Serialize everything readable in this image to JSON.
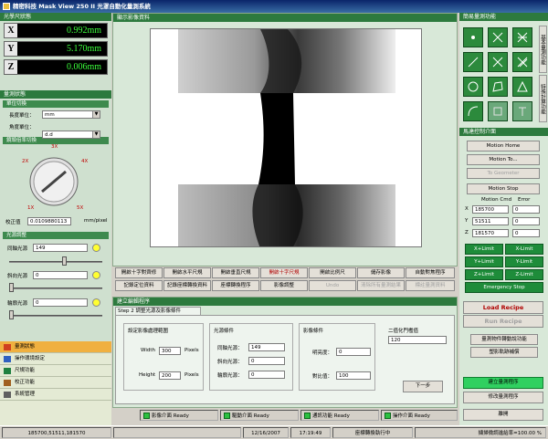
{
  "window": {
    "title": "精密科技 Mask View 250 II 光罩自動化量測系統"
  },
  "coords": {
    "header": "光學尺狀態",
    "rows": [
      {
        "axis": "X",
        "value": "0.992mm"
      },
      {
        "axis": "Y",
        "value": "5.170mm"
      },
      {
        "axis": "Z",
        "value": "0.006mm"
      }
    ]
  },
  "measure": {
    "header": "量測狀態",
    "units_header": "單位切換",
    "length_label": "長度單位：",
    "length_value": "mm",
    "angle_label": "角度單位：",
    "angle_value": "d.d",
    "lens_header": "鏡頭倍率切換",
    "lens_marks": [
      "2X",
      "3X",
      "4X",
      "1X",
      "5X"
    ],
    "calib_label": "校正值",
    "calib_value": "0.0109880113",
    "calib_unit": "mm/pixel",
    "light_header": "光源調整",
    "lights": [
      {
        "label": "同軸光源",
        "value": "149"
      },
      {
        "label": "斜向光源",
        "value": "0"
      },
      {
        "label": "輪廓光源",
        "value": "0"
      }
    ]
  },
  "nav": {
    "items": [
      {
        "label": "量測狀態"
      },
      {
        "label": "操作環境設定"
      },
      {
        "label": "尺規功能"
      },
      {
        "label": "校正功能"
      },
      {
        "label": "系統管理"
      }
    ]
  },
  "image_panel": {
    "header": "顯示影像資料"
  },
  "toolbar": {
    "row1": [
      "開啟十字對齊修",
      "開啟水平尺規",
      "開啟垂直尺規",
      "開啟十字尺規",
      "開啟比例尺",
      "儲存影像",
      "自動對焦程序"
    ],
    "row2": [
      "記錄定位資料",
      "記錄座標轉換資料",
      "座標轉換程序",
      "影像調整",
      "Undo",
      "清除所有量測結果",
      "標註量測資料"
    ]
  },
  "recipe": {
    "header": "建立編輯程序",
    "tab": "Step 2 調整光源及影像條件",
    "range_title": "設定影像處理範圍",
    "width_label": "Width",
    "width_value": "300",
    "height_label": "Height",
    "height_value": "200",
    "unit": "Pixels",
    "light_title": "光源條件",
    "light_rows": [
      {
        "label": "同軸光源：",
        "value": "149"
      },
      {
        "label": "斜向光源：",
        "value": "0"
      },
      {
        "label": "輪廓光源：",
        "value": "0"
      }
    ],
    "image_title": "影像條件",
    "brightness_label": "明亮度：",
    "brightness_value": "0",
    "contrast_label": "對比值：",
    "contrast_value": "100",
    "binary_label": "二值化門檻值",
    "binary_value": "120",
    "next_button": "下一步"
  },
  "status_tabs": [
    "影像介面 Ready",
    "驅動介面 Ready",
    "通訊功能 Ready",
    "操作介面 Ready"
  ],
  "tools": {
    "header": "簡易量測功能",
    "vtabs": [
      "基本量測功能",
      "特殊計算功能"
    ]
  },
  "motion": {
    "header": "馬達控制介面",
    "buttons": [
      "Motion Home",
      "Motion To...",
      "To Geometer",
      "Motion Stop"
    ],
    "cmd_label": "Motion Cmd",
    "err_label": "Error",
    "rows": [
      {
        "axis": "X",
        "cmd": "185700",
        "err": "0"
      },
      {
        "axis": "Y",
        "cmd": "51511",
        "err": "0"
      },
      {
        "axis": "Z",
        "cmd": "181570",
        "err": "0"
      }
    ],
    "limits": [
      [
        "X+Limit",
        "X-Limit"
      ],
      [
        "Y+Limit",
        "Y-Limit"
      ],
      [
        "Z+Limit",
        "Z-Limit"
      ]
    ],
    "emergency": "Emergency Stop"
  },
  "right_actions": {
    "load": "Load Recipe",
    "run": "Run Recipe",
    "b1": "量測物件轉動說功能",
    "b2": "塑影軌跡補償",
    "b3": "建立量測程序",
    "b4": "修改量測程序",
    "leave": "離開"
  },
  "statusbar": {
    "coords": "185700,51511,181570",
    "date": "12/16/2007",
    "time": "17:19:49",
    "mode": "座標轉換執行中",
    "zoom": "擷掃微調進給率=100.00 %"
  }
}
